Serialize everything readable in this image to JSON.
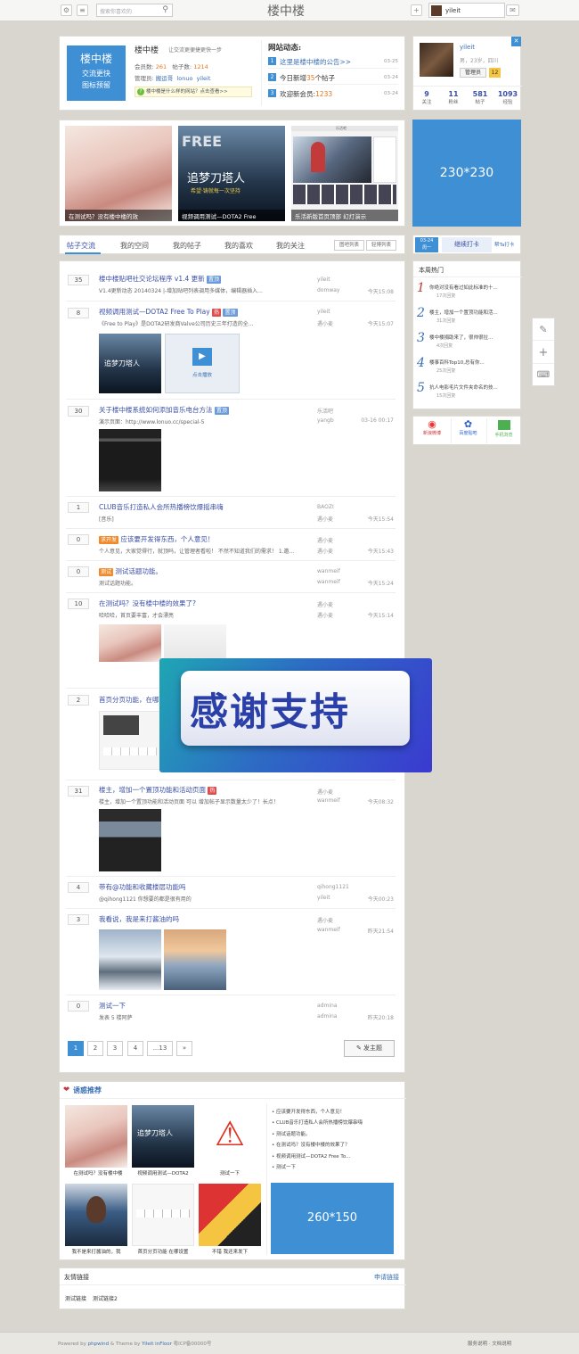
{
  "topbar": {
    "search_placeholder": "搜索你喜欢的",
    "site_title": "楼中楼",
    "username": "yileit"
  },
  "intro": {
    "logo_lines": [
      "楼中楼",
      "交流更快",
      "图标预留"
    ],
    "name": "楼中楼",
    "slogan": "让交流更便捷更快一步",
    "members_label": "会员数:",
    "members": "261",
    "posts_label": "帖子数:",
    "posts": "1214",
    "admins_label": "管理员:",
    "admin1": "搬运哥",
    "admin2": "lonuo",
    "admin3": "yileit",
    "tip": "楼中楼是什么样的网站？点击查看>>"
  },
  "news": {
    "title": "网站动态:",
    "items": [
      {
        "n": "1",
        "text": "这里是楼中楼的公告>>",
        "date": "03-25"
      },
      {
        "n": "2",
        "text_a": "今日新增",
        "num": "35",
        "text_b": "个帖子",
        "date": "03-24"
      },
      {
        "n": "3",
        "text_a": "欢迎新会员:",
        "num": "1233",
        "date": "03-24"
      }
    ]
  },
  "profile": {
    "name": "yileit",
    "info": "男，23岁，四川",
    "role": "管理员",
    "level": "12",
    "stats": [
      {
        "v": "9",
        "l": "关注"
      },
      {
        "v": "11",
        "l": "粉丝"
      },
      {
        "v": "581",
        "l": "帖子"
      },
      {
        "v": "1093",
        "l": "经验"
      }
    ]
  },
  "slider": {
    "caps": [
      "在测试吗？没有楼中楼的效",
      "视频调用测试—DOTA2 Free",
      "乐活新版首页顶部 幻灯演示"
    ],
    "ad": "230*230",
    "poster_top": "FREE",
    "poster_main": "追梦刀塔人",
    "poster_sub": "希望·铸就每一次坚持",
    "news_head": "乐活吧"
  },
  "tabs": {
    "items": [
      "帖子交流",
      "我的空间",
      "我的帖子",
      "我的喜欢",
      "我的关注"
    ],
    "v1": "图吧列表",
    "v2": "轻博列表"
  },
  "checkin": {
    "date1": "03-24",
    "date2": "周一",
    "btn": "继续打卡",
    "help": "帮Ta打卡"
  },
  "hot": {
    "title": "本周热门",
    "items": [
      {
        "n": "1",
        "t": "你绝对没有看过如此标准的十...",
        "c": "17次回复"
      },
      {
        "n": "2",
        "t": "楼主，增加一个置顶功能和活...",
        "c": "31次回复"
      },
      {
        "n": "3",
        "t": "楼中楼捐助来了，很帅很拉...",
        "c": "4次回复"
      },
      {
        "n": "4",
        "t": "楼事百科Top10,总有你...",
        "c": "25次回复"
      },
      {
        "n": "5",
        "t": "抗人电影毛片文件夹命名的技...",
        "c": "15次回复"
      }
    ]
  },
  "share": [
    "新浪微博",
    "百度贴吧",
    "手机浏览"
  ],
  "posts": [
    {
      "cnt": "35",
      "title": "楼中楼贴吧社交论坛程序 v1.4 更新",
      "tag": "置顶",
      "tagc": "blue",
      "desc": "V1.4更新动态 20140324 |-增加贴吧列表调用多媒体，编辑器插入...",
      "a1": "yileit",
      "a2": "domway",
      "t": "今天15:08"
    },
    {
      "cnt": "8",
      "title": "视频调用测试—DOTA2 Free To Play",
      "tag": "热",
      "tag2": "置顶",
      "desc": "《Free to Play》是DOTA2研发商Valve公司历史三年打造的全...",
      "a1": "yileit",
      "a2": "遇小麦",
      "t": "今天15:07",
      "play": "点击播放"
    },
    {
      "cnt": "30",
      "title": "关于楼中楼系统如何添加音乐电台方法",
      "tag": "置顶",
      "desc": "演示页面：http://www.lonuo.cc/special-5",
      "a1": "乐活吧",
      "a2": "yangb",
      "t": "03-16 00:17"
    },
    {
      "cnt": "1",
      "title": "CLUB音乐打造私人会所热播榜饮爆摇串嗨",
      "desc": "[音乐]",
      "a1": "BAOZI",
      "a2": "遇小麦",
      "t": "今天15:54"
    },
    {
      "cnt": "0",
      "pre": "求开发",
      "title": "应该要开发得东西，个人意见！",
      "desc": "个人意见，大家觉得行，就顶吗，让管理者看啦！ 不然不知道我们的需求！ 1.邀...",
      "a1": "遇小麦",
      "a2": "遇小麦",
      "t": "今天15:43"
    },
    {
      "cnt": "0",
      "pre": "测试",
      "title": "测试话题功能。",
      "desc": "测试话题功能。",
      "a1": "wanmeif",
      "a2": "wanmeif",
      "t": "今天15:24"
    },
    {
      "cnt": "10",
      "title": "在测试吗？没有楼中楼的效果了?",
      "desc": "哈哈哈，首页要丰富，才会漂亮",
      "a1": "遇小麦",
      "a2": "遇小麦",
      "t": "今天15:14"
    },
    {
      "cnt": "2",
      "title": "首页分页功能，在哪设",
      "a1": "",
      "a2": "",
      "t": ""
    },
    {
      "cnt": "31",
      "title": "楼主，增加一个置顶功能和活动页面",
      "tag": "热",
      "desc": "楼主，增加一个置顶功能和活动页面 可以 增加帖子显示数量太少了！长点！",
      "a1": "遇小麦",
      "a2": "wanmeif",
      "t": "今天08:32"
    },
    {
      "cnt": "4",
      "title": "带有@功能和收藏楼层功能吗",
      "desc": "@qihong1121 你想要的都是很有用的",
      "a1": "qihong1121",
      "a2": "yileit",
      "t": "今天00:23"
    },
    {
      "cnt": "3",
      "title": "我看说，我是来打酱油的吗",
      "a1": "遇小麦",
      "a2": "wanmeif",
      "t": "昨天21:54"
    },
    {
      "cnt": "0",
      "title": "测试一下",
      "desc": "发表 5 楼阿萨",
      "a1": "admina",
      "a2": "admina",
      "t": "昨天20:18"
    }
  ],
  "pager": {
    "pages": [
      "1",
      "2",
      "3",
      "4",
      "...13",
      "»"
    ],
    "new_topic": "发主题"
  },
  "overlay": "感谢支持",
  "recommend": {
    "title": "诱惑推荐",
    "caps": [
      "在测试吗？没有楼中楼",
      "视频调用测试—DOTA2",
      "测试一下",
      "我不是来打酱油的，我",
      "首页分页功能 在哪设置",
      "不错 我还来发下"
    ],
    "links": [
      "应该要开发得东西，个人意见！",
      "CLUB音乐打造私人会所热播榜饮爆串嗨",
      "测试话题功能。",
      "在测试吗？没有楼中楼的效果了？",
      "视频调用测试—DOTA2 Free To...",
      "测试一下"
    ],
    "ad": "260*150"
  },
  "friends": {
    "title": "友情链接",
    "apply": "申请链接",
    "links": [
      "测试链接",
      "测试链接2"
    ]
  },
  "footer": {
    "left_a": "Powered by",
    "pw": "phpwind",
    "amp": "& Theme by",
    "yi": "Yileit inFloor",
    "icp": "粤ICP备00000号",
    "right": "服务说明 · 文档说明"
  }
}
